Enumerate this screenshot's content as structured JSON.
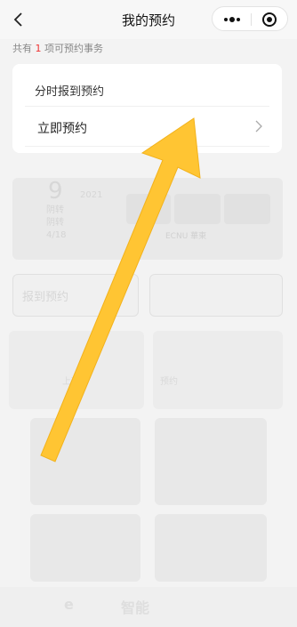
{
  "nav": {
    "title": "我的预约",
    "back_icon": "back-icon",
    "more_icon": "more-icon",
    "close_icon": "target-icon"
  },
  "summary": {
    "prefix": "共有 ",
    "count": "1",
    "suffix": " 项可预约事务"
  },
  "card": {
    "heading": "分时报到预约",
    "action_label": "立即预约",
    "chevron_icon": "chevron-right-icon"
  },
  "background": {
    "weather_temp": "9",
    "weather_small": "2021",
    "weather_lines": [
      "阴转",
      "阴转",
      "4/18"
    ],
    "brand": "ECNU 華東",
    "button_left": "报到预约",
    "tile_caption_1": "上班",
    "tile_caption_2": "预约",
    "tab_text_1": "e",
    "tab_text_2": "智能"
  },
  "overlay": {
    "arrow_color": "#ffc533"
  }
}
